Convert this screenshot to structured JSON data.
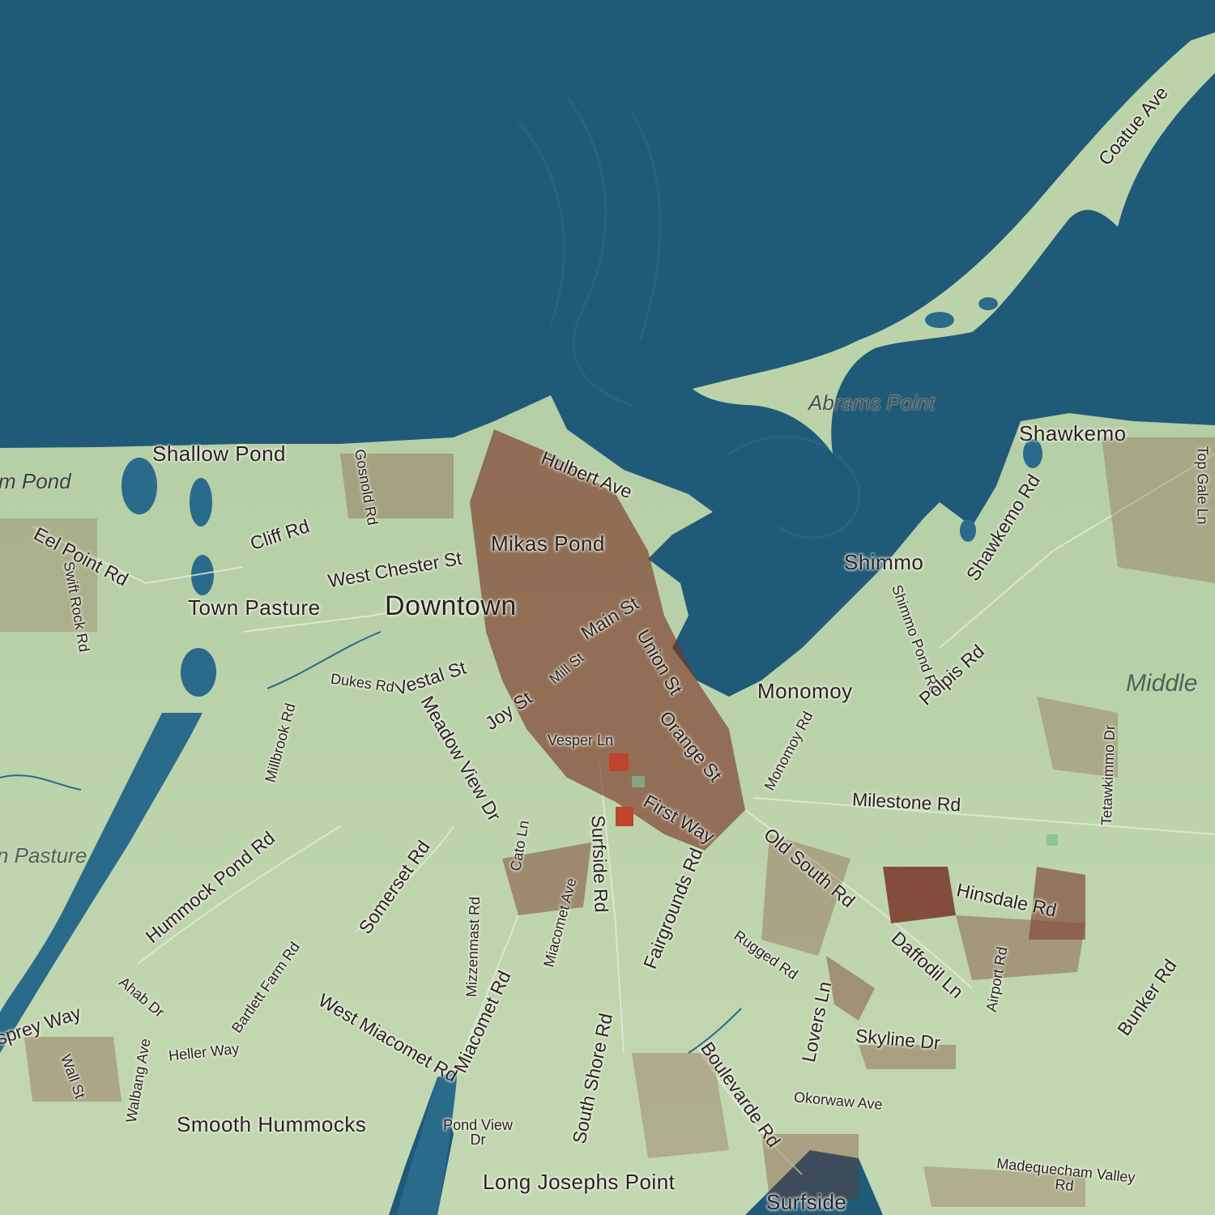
{
  "map": {
    "colors": {
      "ocean": "#1f5a78",
      "land": "#b9d1a8",
      "land_light": "#c9dbb6",
      "buildings": "#7a3426",
      "ponds": "#2a6a8a",
      "roads": "#e8ecdf"
    },
    "places": {
      "downtown": "Downtown",
      "shallow_pond": "Shallow Pond",
      "mikas_pond": "Mikas Pond",
      "town_pasture": "Town Pasture",
      "shimmo": "Shimmo",
      "shawkemo": "Shawkemo",
      "monomoy": "Monomoy",
      "smooth_hummocks": "Smooth Hummocks",
      "long_josephs_point": "Long Josephs Point",
      "surfside": "Surfside"
    },
    "water_labels": {
      "abrams_point": "Abrams Point",
      "pond_left": "m Pond",
      "pasture_left": "n Pasture",
      "middle": "Middle"
    },
    "streets": {
      "coatue_ave": "Coatue Ave",
      "hulbert_ave": "Hulbert Ave",
      "gosnold_rd": "Gosnold Rd",
      "cliff_rd": "Cliff Rd",
      "eel_point_rd": "Eel Point Rd",
      "swift_rock_rd": "Swift Rock Rd",
      "west_chester_st": "West Chester St",
      "main_st": "Main St",
      "vestal_st": "Vestal St",
      "dukes_rd": "Dukes Rd",
      "mill_st": "Mill St",
      "union_st": "Union St",
      "joy_st": "Joy St",
      "orange_st": "Orange St",
      "millbrook_rd": "Millbrook Rd",
      "meadow_view_dr": "Meadow View Dr",
      "vesper_ln": "Vesper Ln",
      "shawkemo_rd": "Shawkemo Rd",
      "shimmo_pond_rd": "Shimmo Pond Rd",
      "polpis_rd": "Polpis Rd",
      "monomoy_rd": "Monomoy Rd",
      "tetawkimmo_dr": "Tetawkimmo Dr",
      "milestone_rd": "Milestone Rd",
      "top_gale_ln": "Top Gale Ln",
      "first_way": "First Way",
      "surfside_rd": "Surfside Rd",
      "cato_ln": "Cato Ln",
      "somerset_rd": "Somerset Rd",
      "hummock_pond_rd": "Hummock Pond Rd",
      "old_south_rd": "Old South Rd",
      "hinsdale_rd": "Hinsdale Rd",
      "fairgrounds_rd": "Fairgrounds Rd",
      "mizzenmast_rd": "Mizzenmast Rd",
      "miacomet_ave": "Miacomet Ave",
      "daffodil_ln": "Daffodil Ln",
      "airport_rd": "Airport Rd",
      "rugged_rd": "Rugged Rd",
      "bunker_rd": "Bunker Rd",
      "bartlett_farm_rd": "Bartlett Farm Rd",
      "ahab_dr": "Ahab Dr",
      "osprey_way": "sprey Way",
      "west_miacomet_rd": "West Miacomet Rd",
      "miacomet_rd": "Miacomet Rd",
      "lovers_ln": "Lovers Ln",
      "skyline_dr": "Skyline Dr",
      "heller_way": "Heller Way",
      "wall_st": "Wall St",
      "walbang_ave": "Walbang Ave",
      "south_shore_rd": "South Shore Rd",
      "boulevarde_rd": "Boulevarde Rd",
      "okorwaw_ave": "Okorwaw Ave",
      "pond_view_dr": "Pond View Dr",
      "madequecham_valley_rd": "Madequecham Valley Rd"
    }
  }
}
